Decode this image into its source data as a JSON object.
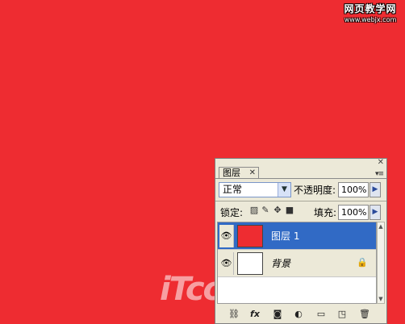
{
  "watermark": {
    "top_title": "网页教学网",
    "top_url": "www.webjx.com",
    "bottom_text": "iTcom.cn"
  },
  "colors": {
    "canvas": "#ee2c31",
    "panel": "#ece9d8",
    "selection": "#316ac5"
  },
  "panel": {
    "tab_label": "图层",
    "tab_close_icon": "close-icon",
    "panel_close_icon": "close-icon",
    "menu_icon": "panel-menu-icon",
    "blend_mode": "正常",
    "opacity_label": "不透明度:",
    "opacity_value": "100%",
    "lock_label": "锁定:",
    "fill_label": "填充:",
    "fill_value": "100%",
    "lock_icons": [
      "lock-transparent-icon",
      "lock-paint-icon",
      "lock-move-icon",
      "lock-all-icon"
    ]
  },
  "layers": [
    {
      "name": "图层 1",
      "visible": true,
      "selected": true,
      "thumb_color": "#ee2c31",
      "locked": false
    },
    {
      "name": "背景",
      "visible": true,
      "selected": false,
      "thumb_color": "#ffffff",
      "locked": true
    }
  ],
  "bottom_icons": [
    "link-icon",
    "fx-icon",
    "mask-icon",
    "adjustment-icon",
    "folder-icon",
    "new-layer-icon",
    "trash-icon"
  ]
}
